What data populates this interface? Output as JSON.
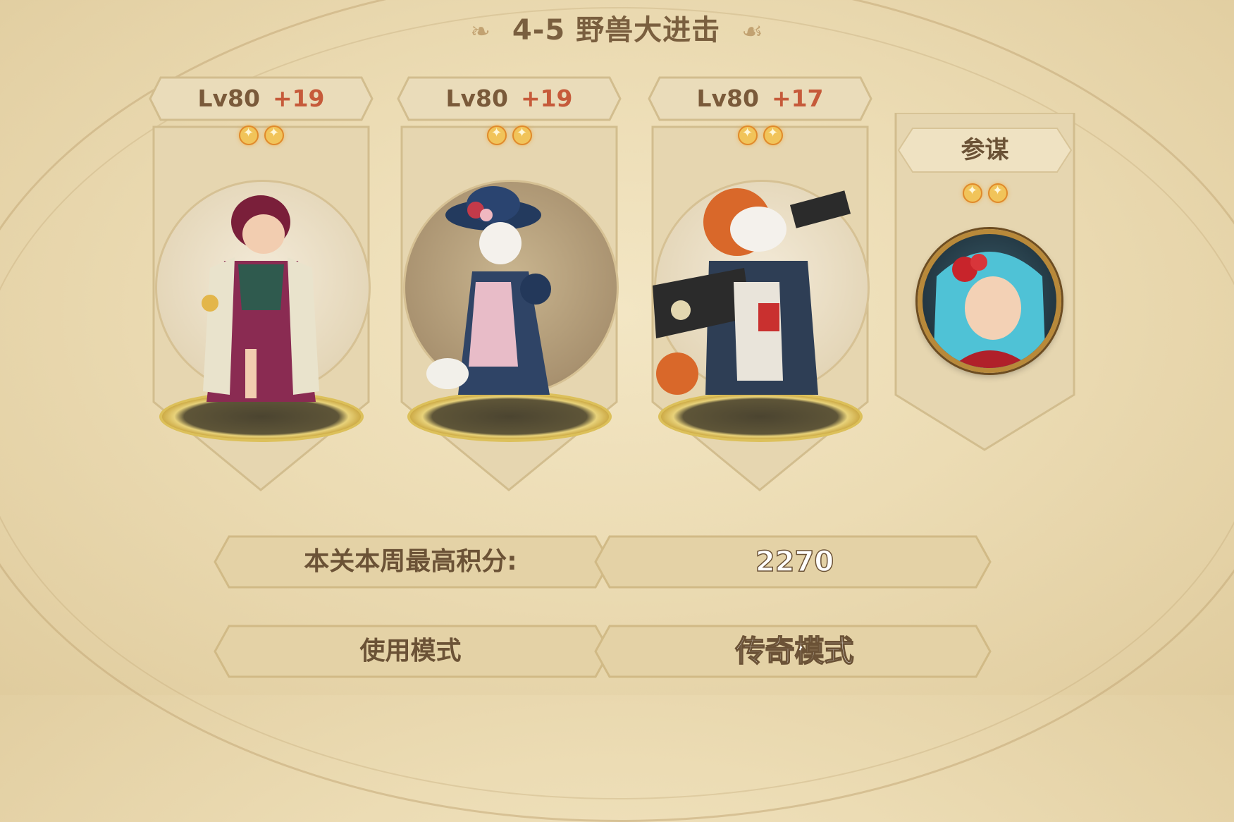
{
  "stage": {
    "title": "4-5 野兽大进击"
  },
  "heroes": [
    {
      "level": "Lv80",
      "bonus": "+19",
      "stars": 2
    },
    {
      "level": "Lv80",
      "bonus": "+19",
      "stars": 2
    },
    {
      "level": "Lv80",
      "bonus": "+17",
      "stars": 2
    }
  ],
  "strategist": {
    "label": "参谋",
    "stars": 2
  },
  "score": {
    "label": "本关本周最高积分:",
    "value": "2270"
  },
  "modes": {
    "normal_label": "使用模式",
    "legend_label": "传奇模式"
  },
  "colors": {
    "accent": "#c65a3a",
    "panel": "#e3d1a8",
    "gold": "#dcc05a"
  }
}
